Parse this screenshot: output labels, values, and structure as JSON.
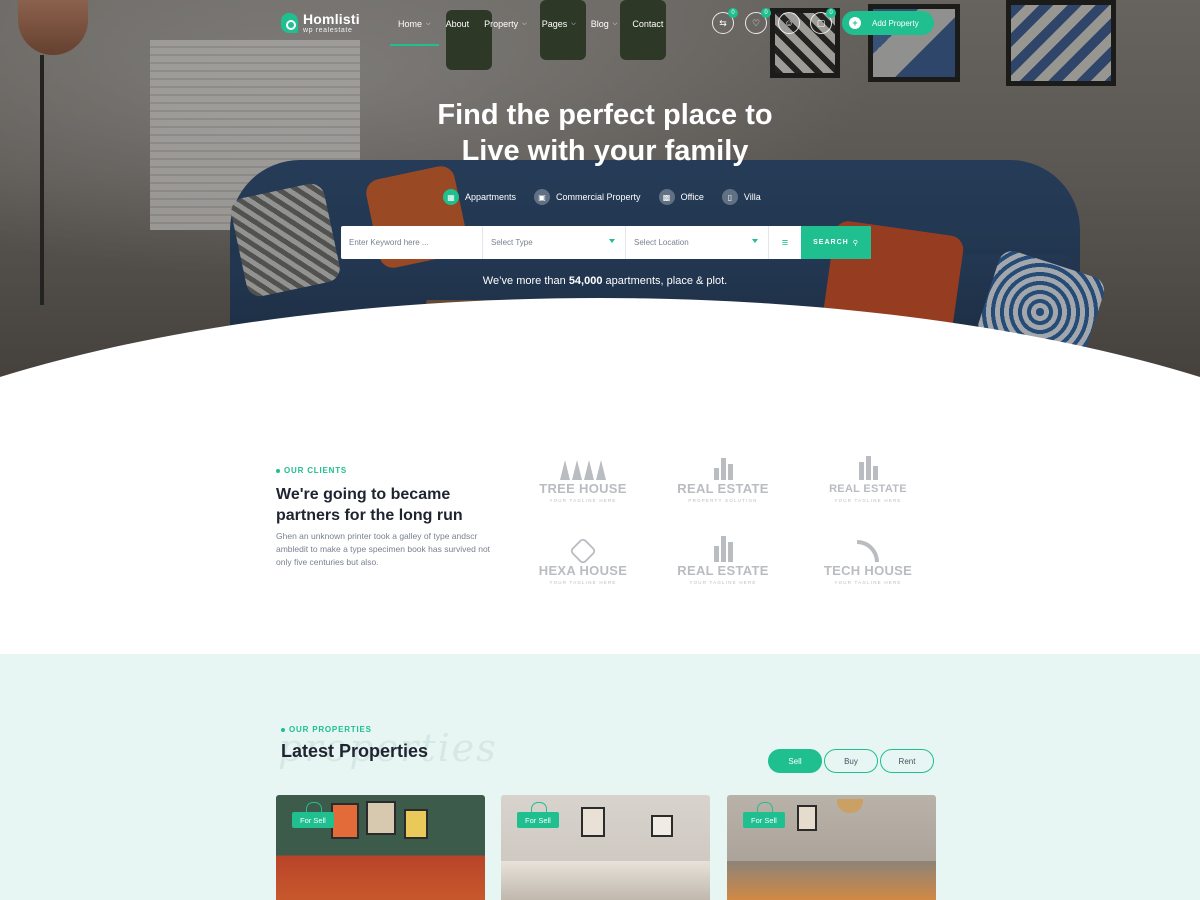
{
  "brand": {
    "name": "Homlisti",
    "tagline": "wp realestate"
  },
  "nav": {
    "items": [
      {
        "label": "Home",
        "has_dropdown": true,
        "active": true
      },
      {
        "label": "About",
        "has_dropdown": false,
        "active": false
      },
      {
        "label": "Property",
        "has_dropdown": true,
        "active": false
      },
      {
        "label": "Pages",
        "has_dropdown": true,
        "active": false
      },
      {
        "label": "Blog",
        "has_dropdown": true,
        "active": false
      },
      {
        "label": "Contact",
        "has_dropdown": false,
        "active": false
      }
    ],
    "compare_count": "0",
    "wishlist_count": "0",
    "cart_count": "0",
    "add_property_label": "Add Property"
  },
  "hero": {
    "title_line1": "Find the perfect place to",
    "title_line2": "Live with your family",
    "categories": [
      {
        "label": "Appartments",
        "icon": "building-icon",
        "active": true
      },
      {
        "label": "Commercial Property",
        "icon": "store-icon",
        "active": false
      },
      {
        "label": "Office",
        "icon": "briefcase-icon",
        "active": false
      },
      {
        "label": "Villa",
        "icon": "villa-icon",
        "active": false
      }
    ],
    "search": {
      "keyword_placeholder": "Enter Keyword here ...",
      "type_placeholder": "Select Type",
      "location_placeholder": "Select Location",
      "button_label": "SEARCH"
    },
    "tagline_before": "We’ve more than ",
    "tagline_count": "54,000",
    "tagline_after": " apartments, place & plot."
  },
  "clients": {
    "eyebrow": "OUR CLIENTS",
    "title": "We're going to became partners for the long run",
    "description": "Ghen an unknown printer took a galley of type andscr ambledit to make a type specimen book has survived not only five centuries but also.",
    "logos": [
      {
        "name": "TREE HOUSE",
        "tag": "YOUR TAGLINE HERE"
      },
      {
        "name": "REAL ESTATE",
        "tag": "PROPERTY SOLUTION"
      },
      {
        "name": "REAL ESTATE",
        "tag": "YOUR TAGLINE HERE"
      },
      {
        "name": "HEXA HOUSE",
        "tag": "YOUR TAGLINE HERE"
      },
      {
        "name": "REAL ESTATE",
        "tag": "YOUR TAGLINE HERE"
      },
      {
        "name": "TECH HOUSE",
        "tag": "YOUR TAGLINE HERE"
      }
    ]
  },
  "properties": {
    "eyebrow": "OUR PROPERTIES",
    "ghost": "properties",
    "title": "Latest Properties",
    "filters": [
      {
        "label": "Sell",
        "active": true
      },
      {
        "label": "Buy",
        "active": false
      },
      {
        "label": "Rent",
        "active": false
      }
    ],
    "cards": [
      {
        "tag": "For Sell"
      },
      {
        "tag": "For Sell"
      },
      {
        "tag": "For Sell"
      }
    ]
  },
  "colors": {
    "accent": "#1fbf8f",
    "section_bg": "#e8f6f3",
    "text_dark": "#1f2430",
    "text_muted": "#7a8090"
  }
}
